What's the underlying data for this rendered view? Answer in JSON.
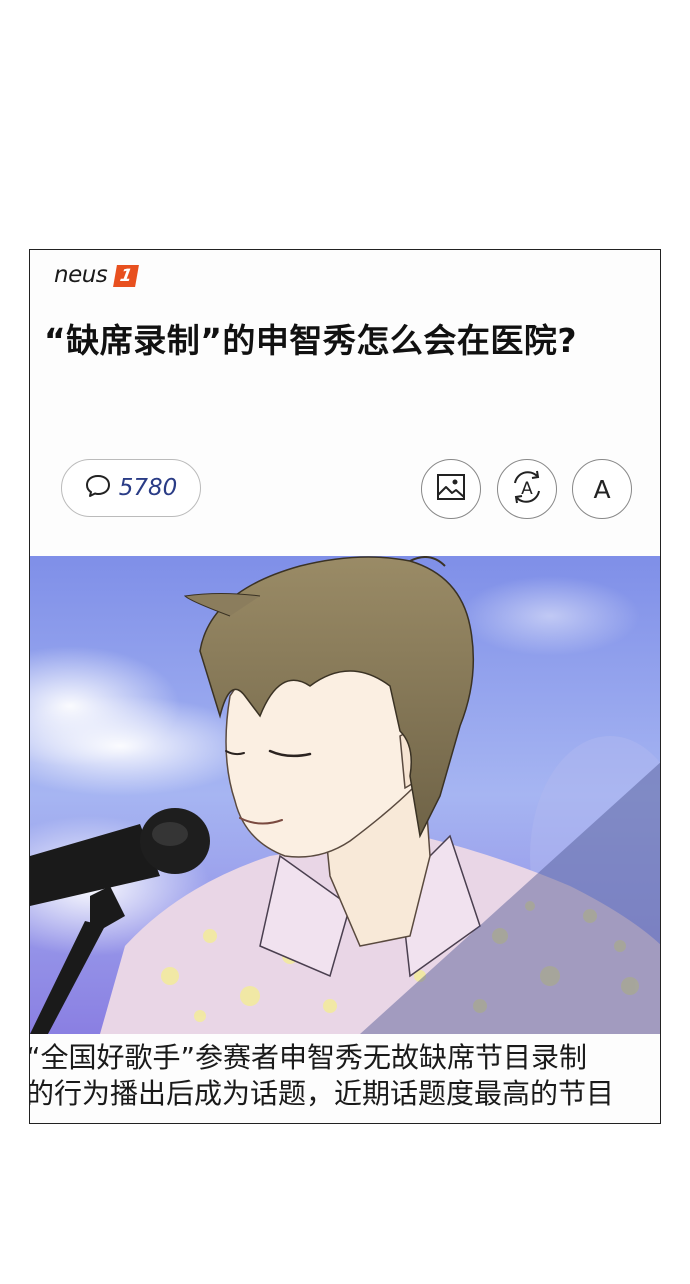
{
  "brand": {
    "name": "neus",
    "badge": "1",
    "accent": "#e8501f"
  },
  "article": {
    "headline": "“缺席录制”的申智秀怎么会在医院?",
    "caption_lines": [
      "“全国好歌手”参赛者申智秀无故缺席节目录制",
      "的行为播出后成为话题，近期话题度最高的节目"
    ]
  },
  "toolbar": {
    "comment_count": "5780",
    "comment_icon": "speech-bubble-icon",
    "image_icon": "image-icon",
    "translate_icon": "auto-translate-icon",
    "font_label": "A",
    "translate_glyph": "A"
  },
  "illustration": {
    "subject": "singer-with-microphone",
    "sky_color": "#8fa2f0",
    "shirt_color": "#e8d6e6",
    "hair_color": "#8b7d5d"
  }
}
